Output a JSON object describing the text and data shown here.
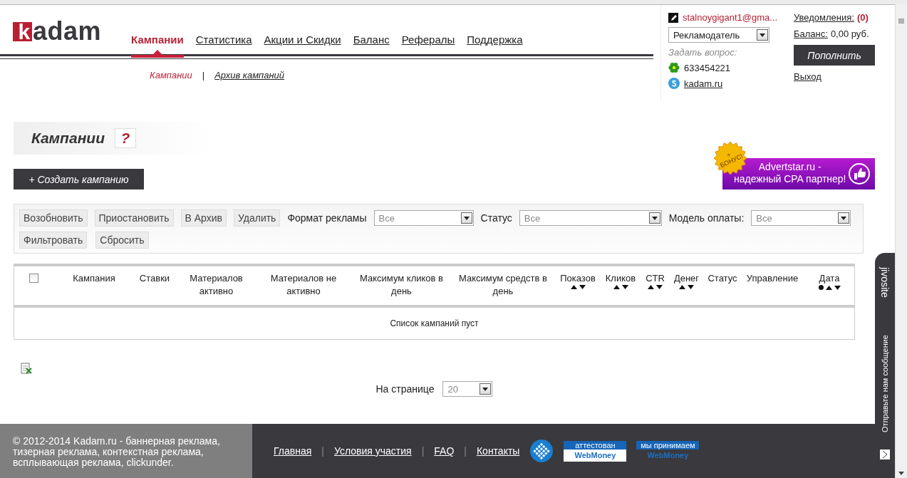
{
  "logo": {
    "text": "kadam"
  },
  "nav": [
    {
      "label": "Кампании",
      "selected": true
    },
    {
      "label": "Статистика",
      "selected": false
    },
    {
      "label": "Акции и Скидки",
      "selected": false
    },
    {
      "label": "Баланс",
      "selected": false
    },
    {
      "label": "Рефералы",
      "selected": false
    },
    {
      "label": "Поддержка",
      "selected": false
    }
  ],
  "subnav": [
    {
      "label": "Кампании",
      "selected": true
    },
    {
      "label": "Архив кампаний",
      "selected": false
    }
  ],
  "subnav_separator": "|",
  "user": {
    "email": "stalnoygigant1@gma...",
    "role": "Рекламодатель",
    "ask_label": "Задать вопрос:",
    "icq": "633454221",
    "skype": "kadam.ru",
    "notifications_label": "Уведомления:",
    "notifications_count": "(0)",
    "balance_label": "Баланс:",
    "balance_value": "0,00 руб.",
    "topup_button": "Пополнить",
    "logout": "Выход"
  },
  "page_title": "Кампании",
  "help_mark": "?",
  "create_button": "+ Создать кампанию",
  "promo": {
    "badge_plus": "+",
    "badge": "БОНУС!",
    "lines": [
      "Advertstar.ru -",
      "надежный CPA партнер!"
    ]
  },
  "filters": {
    "actions": [
      "Возобновить",
      "Приостановить",
      "В Архив",
      "Удалить"
    ],
    "selects": [
      {
        "label": "Формат рекламы",
        "value": "Все"
      },
      {
        "label": "Статус",
        "value": "Все"
      },
      {
        "label": "Модель оплаты:",
        "value": "Все"
      }
    ],
    "buttons": [
      "Фильтровать",
      "Сбросить"
    ]
  },
  "table": {
    "select_all_checked": false,
    "columns": [
      {
        "label": "Кампания",
        "sortable": false,
        "sorted": false
      },
      {
        "label": "Ставки",
        "sortable": false,
        "sorted": false
      },
      {
        "label": "Материалов активно",
        "sortable": false,
        "sorted": false
      },
      {
        "label": "Материалов не активно",
        "sortable": false,
        "sorted": false
      },
      {
        "label": "Максимум кликов в день",
        "sortable": false,
        "sorted": false
      },
      {
        "label": "Максимум средств в день",
        "sortable": false,
        "sorted": false
      },
      {
        "label": "Показов",
        "sortable": true,
        "sorted": false
      },
      {
        "label": "Кликов",
        "sortable": true,
        "sorted": false
      },
      {
        "label": "CTR",
        "sortable": true,
        "sorted": false
      },
      {
        "label": "Денег",
        "sortable": true,
        "sorted": false
      },
      {
        "label": "Статус",
        "sortable": false,
        "sorted": false
      },
      {
        "label": "Управление",
        "sortable": false,
        "sorted": false
      },
      {
        "label": "Дата",
        "sortable": true,
        "sorted": true
      }
    ],
    "empty_message": "Список кампаний пуст"
  },
  "pagination": {
    "label": "На странице",
    "value": "20"
  },
  "footer": {
    "copyright": "© 2012-2014 Kadam.ru - баннерная реклама, тизерная реклама, контекстная реклама, всплывающая реклама, clickunder.",
    "links": [
      "Главная",
      "Условия участия",
      "FAQ",
      "Контакты"
    ],
    "link_separator": "|",
    "badges": [
      {
        "top": "аттестован",
        "bottom": "WebMoney",
        "framed": true
      },
      {
        "top": "мы принимаем",
        "bottom": "WebMoney",
        "framed": false
      }
    ]
  },
  "chat_widget": {
    "brand": "jivosite",
    "text": "Отправьте нам сообщение"
  }
}
